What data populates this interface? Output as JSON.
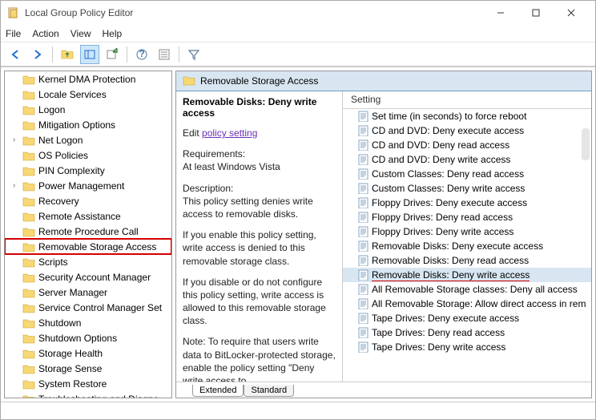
{
  "window": {
    "title": "Local Group Policy Editor"
  },
  "menu": [
    "File",
    "Action",
    "View",
    "Help"
  ],
  "crumb": "Removable Storage Access",
  "desc": {
    "title": "Removable Disks: Deny write access",
    "edit_prefix": "Edit",
    "edit_link": "policy setting",
    "req_h": "Requirements:",
    "req_v": "At least Windows Vista",
    "desc_h": "Description:",
    "desc_v": "This policy setting denies write access to removable disks.",
    "enable": "If you enable this policy setting, write access is denied to this removable storage class.",
    "disable": "If you disable or do not configure this policy setting, write access is allowed to this removable storage class.",
    "note": "Note: To require that users write data to BitLocker-protected storage, enable the policy setting \"Deny write access to"
  },
  "list_header": "Setting",
  "tree": [
    {
      "l": "Kernel DMA Protection"
    },
    {
      "l": "Locale Services"
    },
    {
      "l": "Logon"
    },
    {
      "l": "Mitigation Options"
    },
    {
      "l": "Net Logon",
      "exp": true
    },
    {
      "l": "OS Policies"
    },
    {
      "l": "PIN Complexity"
    },
    {
      "l": "Power Management",
      "exp": true
    },
    {
      "l": "Recovery"
    },
    {
      "l": "Remote Assistance"
    },
    {
      "l": "Remote Procedure Call"
    },
    {
      "l": "Removable Storage Access",
      "sel": true
    },
    {
      "l": "Scripts"
    },
    {
      "l": "Security Account Manager"
    },
    {
      "l": "Server Manager"
    },
    {
      "l": "Service Control Manager Set"
    },
    {
      "l": "Shutdown"
    },
    {
      "l": "Shutdown Options"
    },
    {
      "l": "Storage Health"
    },
    {
      "l": "Storage Sense"
    },
    {
      "l": "System Restore"
    },
    {
      "l": "Troubleshooting and Diagnc"
    }
  ],
  "settings": [
    {
      "l": "Set time (in seconds) to force reboot"
    },
    {
      "l": "CD and DVD: Deny execute access"
    },
    {
      "l": "CD and DVD: Deny read access"
    },
    {
      "l": "CD and DVD: Deny write access"
    },
    {
      "l": "Custom Classes: Deny read access"
    },
    {
      "l": "Custom Classes: Deny write access"
    },
    {
      "l": "Floppy Drives: Deny execute access"
    },
    {
      "l": "Floppy Drives: Deny read access"
    },
    {
      "l": "Floppy Drives: Deny write access"
    },
    {
      "l": "Removable Disks: Deny execute access"
    },
    {
      "l": "Removable Disks: Deny read access"
    },
    {
      "l": "Removable Disks: Deny write access",
      "sel": true
    },
    {
      "l": "All Removable Storage classes: Deny all access"
    },
    {
      "l": "All Removable Storage: Allow direct access in rem"
    },
    {
      "l": "Tape Drives: Deny execute access"
    },
    {
      "l": "Tape Drives: Deny read access"
    },
    {
      "l": "Tape Drives: Deny write access"
    }
  ],
  "tabs": {
    "extended": "Extended",
    "standard": "Standard"
  }
}
